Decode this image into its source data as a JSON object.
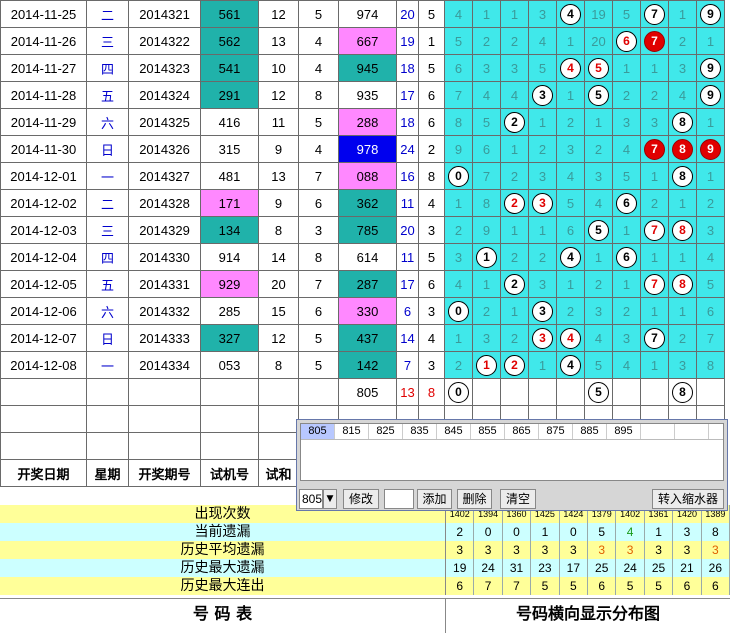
{
  "rows": [
    {
      "date": "2014-11-25",
      "wd": "二",
      "issue": "2014321",
      "draw": "561",
      "drawBg": "teal",
      "s1": "12",
      "s2": "5",
      "test": "974",
      "testBg": "",
      "sp": "20",
      "k": "5",
      "balls": [
        {
          "pos": 4,
          "v": "4"
        },
        {
          "pos": 7,
          "v": "7"
        },
        {
          "pos": 9,
          "v": "9"
        }
      ],
      "misc": [
        "4",
        "1",
        "1",
        "3",
        "",
        "19",
        "5",
        "",
        "1",
        ""
      ]
    },
    {
      "date": "2014-11-26",
      "wd": "三",
      "issue": "2014322",
      "draw": "562",
      "drawBg": "teal",
      "s1": "13",
      "s2": "4",
      "test": "667",
      "testBg": "pink",
      "sp": "19",
      "k": "1",
      "balls": [
        {
          "pos": 6,
          "v": "6",
          "style": "rt"
        },
        {
          "pos": 7,
          "v": "7",
          "style": "r"
        }
      ],
      "misc": [
        "5",
        "2",
        "2",
        "4",
        "1",
        "20",
        "",
        "",
        "2",
        "1"
      ]
    },
    {
      "date": "2014-11-27",
      "wd": "四",
      "issue": "2014323",
      "draw": "541",
      "drawBg": "teal",
      "s1": "10",
      "s2": "4",
      "test": "945",
      "testBg": "teal",
      "sp": "18",
      "k": "5",
      "balls": [
        {
          "pos": 4,
          "v": "4",
          "style": "rt"
        },
        {
          "pos": 5,
          "v": "5",
          "style": "rt"
        },
        {
          "pos": 9,
          "v": "9"
        }
      ],
      "misc": [
        "6",
        "3",
        "3",
        "5",
        "",
        "",
        "1",
        "1",
        "3",
        ""
      ]
    },
    {
      "date": "2014-11-28",
      "wd": "五",
      "issue": "2014324",
      "draw": "291",
      "drawBg": "teal",
      "s1": "12",
      "s2": "8",
      "test": "935",
      "testBg": "",
      "sp": "17",
      "k": "6",
      "balls": [
        {
          "pos": 3,
          "v": "3"
        },
        {
          "pos": 5,
          "v": "5"
        },
        {
          "pos": 9,
          "v": "9"
        }
      ],
      "misc": [
        "7",
        "4",
        "4",
        "",
        "1",
        "",
        "2",
        "2",
        "4",
        ""
      ]
    },
    {
      "date": "2014-11-29",
      "wd": "六",
      "issue": "2014325",
      "draw": "416",
      "drawBg": "",
      "s1": "11",
      "s2": "5",
      "test": "288",
      "testBg": "pink",
      "sp": "18",
      "k": "6",
      "balls": [
        {
          "pos": 2,
          "v": "2"
        },
        {
          "pos": 8,
          "v": "8"
        }
      ],
      "misc": [
        "8",
        "5",
        "",
        "1",
        "2",
        "1",
        "3",
        "3",
        "",
        "1"
      ]
    },
    {
      "date": "2014-11-30",
      "wd": "日",
      "issue": "2014326",
      "draw": "315",
      "drawBg": "",
      "s1": "9",
      "s2": "4",
      "test": "978",
      "testBg": "blue",
      "sp": "24",
      "k": "2",
      "balls": [
        {
          "pos": 7,
          "v": "7",
          "style": "r"
        },
        {
          "pos": 8,
          "v": "8",
          "style": "r"
        },
        {
          "pos": 9,
          "v": "9",
          "style": "r"
        }
      ],
      "misc": [
        "9",
        "6",
        "1",
        "2",
        "3",
        "2",
        "4",
        "",
        "",
        ""
      ]
    },
    {
      "date": "2014-12-01",
      "wd": "一",
      "issue": "2014327",
      "draw": "481",
      "drawBg": "",
      "s1": "13",
      "s2": "7",
      "test": "088",
      "testBg": "pink",
      "sp": "16",
      "k": "8",
      "balls": [
        {
          "pos": 0,
          "v": "0"
        },
        {
          "pos": 8,
          "v": "8"
        }
      ],
      "misc": [
        "",
        "7",
        "2",
        "3",
        "4",
        "3",
        "5",
        "1",
        "",
        "1"
      ]
    },
    {
      "date": "2014-12-02",
      "wd": "二",
      "issue": "2014328",
      "draw": "171",
      "drawBg": "pink",
      "s1": "9",
      "s2": "6",
      "test": "362",
      "testBg": "teal",
      "sp": "11",
      "k": "4",
      "balls": [
        {
          "pos": 2,
          "v": "2",
          "style": "rt"
        },
        {
          "pos": 3,
          "v": "3",
          "style": "rt"
        },
        {
          "pos": 6,
          "v": "6"
        }
      ],
      "misc": [
        "1",
        "8",
        "",
        "",
        "5",
        "4",
        "",
        "2",
        "1",
        "2"
      ]
    },
    {
      "date": "2014-12-03",
      "wd": "三",
      "issue": "2014329",
      "draw": "134",
      "drawBg": "teal",
      "s1": "8",
      "s2": "3",
      "test": "785",
      "testBg": "teal",
      "sp": "20",
      "k": "3",
      "balls": [
        {
          "pos": 5,
          "v": "5"
        },
        {
          "pos": 7,
          "v": "7",
          "style": "rt"
        },
        {
          "pos": 8,
          "v": "8",
          "style": "rt"
        }
      ],
      "misc": [
        "2",
        "9",
        "1",
        "1",
        "6",
        "",
        "1",
        "",
        "",
        "3"
      ]
    },
    {
      "date": "2014-12-04",
      "wd": "四",
      "issue": "2014330",
      "draw": "914",
      "drawBg": "",
      "s1": "14",
      "s2": "8",
      "test": "614",
      "testBg": "",
      "sp": "11",
      "k": "5",
      "balls": [
        {
          "pos": 1,
          "v": "1"
        },
        {
          "pos": 4,
          "v": "4"
        },
        {
          "pos": 6,
          "v": "6"
        }
      ],
      "misc": [
        "3",
        "",
        "2",
        "2",
        "",
        "1",
        "",
        "1",
        "1",
        "4"
      ]
    },
    {
      "date": "2014-12-05",
      "wd": "五",
      "issue": "2014331",
      "draw": "929",
      "drawBg": "pink",
      "s1": "20",
      "s2": "7",
      "test": "287",
      "testBg": "teal",
      "sp": "17",
      "k": "6",
      "balls": [
        {
          "pos": 2,
          "v": "2"
        },
        {
          "pos": 7,
          "v": "7",
          "style": "rt"
        },
        {
          "pos": 8,
          "v": "8",
          "style": "rt"
        }
      ],
      "misc": [
        "4",
        "1",
        "",
        "3",
        "1",
        "2",
        "1",
        "",
        "",
        "5"
      ]
    },
    {
      "date": "2014-12-06",
      "wd": "六",
      "issue": "2014332",
      "draw": "285",
      "drawBg": "",
      "s1": "15",
      "s2": "6",
      "test": "330",
      "testBg": "pink",
      "sp": "6",
      "k": "3",
      "balls": [
        {
          "pos": 0,
          "v": "0"
        },
        {
          "pos": 3,
          "v": "3"
        }
      ],
      "misc": [
        "",
        "2",
        "1",
        "",
        "2",
        "3",
        "2",
        "1",
        "1",
        "6"
      ]
    },
    {
      "date": "2014-12-07",
      "wd": "日",
      "issue": "2014333",
      "draw": "327",
      "drawBg": "teal",
      "s1": "12",
      "s2": "5",
      "test": "437",
      "testBg": "teal",
      "sp": "14",
      "k": "4",
      "balls": [
        {
          "pos": 3,
          "v": "3",
          "style": "rt"
        },
        {
          "pos": 4,
          "v": "4",
          "style": "rt"
        },
        {
          "pos": 7,
          "v": "7"
        }
      ],
      "misc": [
        "1",
        "3",
        "2",
        "",
        "",
        "4",
        "3",
        "",
        "2",
        "7"
      ]
    },
    {
      "date": "2014-12-08",
      "wd": "一",
      "issue": "2014334",
      "draw": "053",
      "drawBg": "",
      "s1": "8",
      "s2": "5",
      "test": "142",
      "testBg": "teal",
      "sp": "7",
      "k": "3",
      "balls": [
        {
          "pos": 1,
          "v": "1",
          "style": "rt"
        },
        {
          "pos": 2,
          "v": "2",
          "style": "rt"
        },
        {
          "pos": 4,
          "v": "4"
        }
      ],
      "misc": [
        "2",
        "",
        "",
        "1",
        "",
        "5",
        "4",
        "1",
        "3",
        "8"
      ]
    }
  ],
  "summaryRow": {
    "test": "805",
    "sp": "13",
    "k": "8",
    "balls": [
      {
        "pos": 0,
        "v": "0"
      },
      {
        "pos": 5,
        "v": "5"
      },
      {
        "pos": 8,
        "v": "8"
      }
    ]
  },
  "headers": {
    "date": "开奖日期",
    "wd": "星期",
    "issue": "开奖期号",
    "test": "试机号",
    "s": "试和"
  },
  "stats": [
    {
      "label": "出现次数",
      "bg": "#ffff99",
      "values": [
        "1402",
        "1394",
        "1360",
        "1425",
        "1424",
        "1379",
        "1402",
        "1361",
        "1420",
        "1389"
      ],
      "small": true
    },
    {
      "label": "当前遗漏",
      "bg": "#ccffff",
      "values": [
        "2",
        "0",
        "0",
        "1",
        "0",
        "5",
        "4",
        "1",
        "3",
        "8"
      ],
      "colors": [
        "",
        "",
        "",
        "",
        "",
        "",
        "#1a9a1a",
        "",
        "",
        ""
      ]
    },
    {
      "label": "历史平均遗漏",
      "bg": "#ffff99",
      "values": [
        "3",
        "3",
        "3",
        "3",
        "3",
        "3",
        "3",
        "3",
        "3",
        "3"
      ],
      "colors": [
        "",
        "",
        "",
        "",
        "",
        "#e06000",
        "#e06000",
        "",
        "",
        "#e06000"
      ]
    },
    {
      "label": "历史最大遗漏",
      "bg": "#ccffff",
      "values": [
        "19",
        "24",
        "31",
        "23",
        "17",
        "25",
        "24",
        "25",
        "21",
        "26"
      ]
    },
    {
      "label": "历史最大连出",
      "bg": "#ffff99",
      "values": [
        "6",
        "7",
        "7",
        "5",
        "5",
        "6",
        "5",
        "5",
        "6",
        "6"
      ]
    }
  ],
  "footer": {
    "left": "号  码  表",
    "right": "号码横向显示分布图"
  },
  "dialog": {
    "tabs": [
      "805",
      "815",
      "825",
      "835",
      "845",
      "855",
      "865",
      "875",
      "885",
      "895",
      "",
      ""
    ],
    "select_value": "805",
    "btn_edit": "修改",
    "btn_add": "添加",
    "btn_delete": "删除",
    "btn_clear": "清空",
    "btn_shrink": "转入缩水器"
  },
  "colors": {
    "teal": "#20b2aa",
    "pink": "#ff88ff",
    "cyan": "#40e8ea",
    "blue": "#0000ee",
    "red": "#e00000"
  }
}
